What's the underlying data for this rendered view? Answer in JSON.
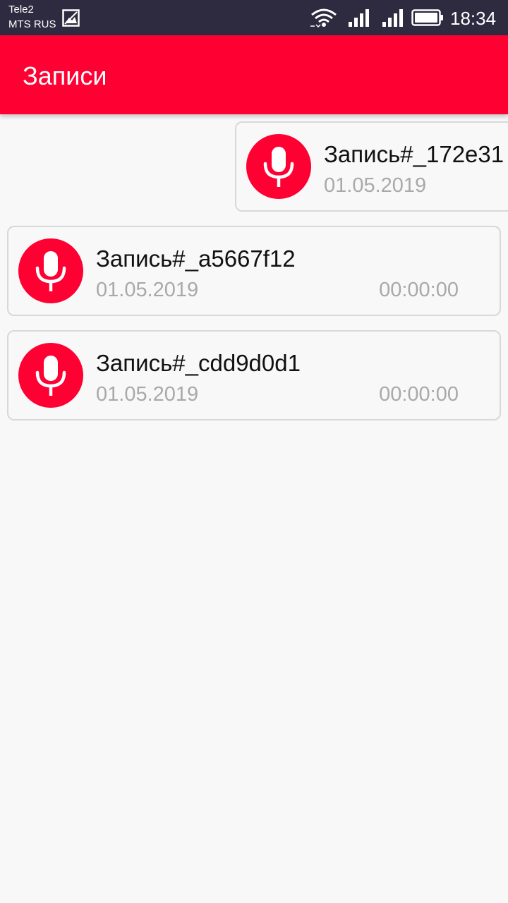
{
  "status_bar": {
    "carrier1": "Tele2",
    "carrier2": "MTS RUS",
    "time": "18:34"
  },
  "app_bar": {
    "title": "Записи",
    "color": "#ff0033"
  },
  "recordings": [
    {
      "name": "Запись#_172e31",
      "date": "01.05.2019",
      "duration": ""
    },
    {
      "name": "Запись#_a5667f12",
      "date": "01.05.2019",
      "duration": "00:00:00"
    },
    {
      "name": "Запись#_cdd9d0d1",
      "date": "01.05.2019",
      "duration": "00:00:00"
    }
  ],
  "icons": {
    "recording_icon": "microphone-icon",
    "status": [
      "gallery-icon",
      "wifi-icon",
      "signal-icon",
      "signal-icon",
      "battery-icon"
    ]
  }
}
